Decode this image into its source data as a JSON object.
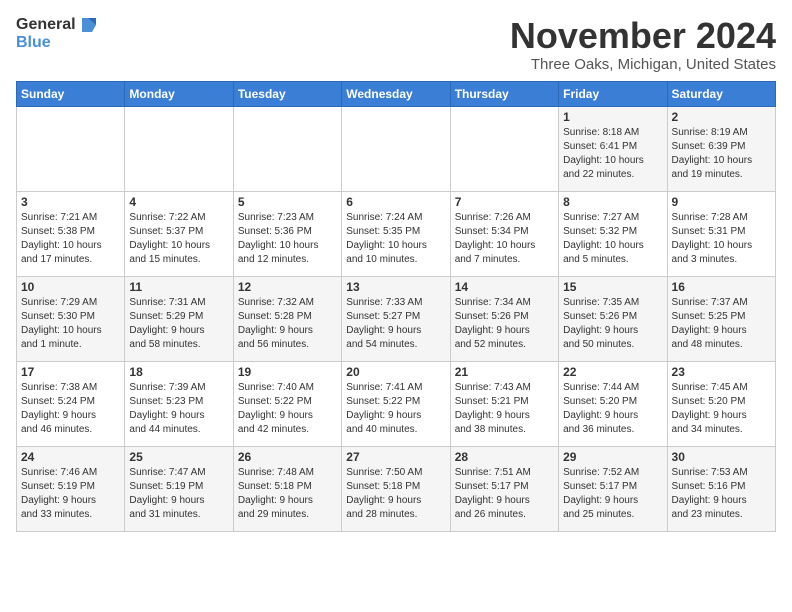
{
  "logo": {
    "line1": "General",
    "line2": "Blue"
  },
  "title": "November 2024",
  "location": "Three Oaks, Michigan, United States",
  "weekdays": [
    "Sunday",
    "Monday",
    "Tuesday",
    "Wednesday",
    "Thursday",
    "Friday",
    "Saturday"
  ],
  "weeks": [
    [
      {
        "day": "",
        "detail": ""
      },
      {
        "day": "",
        "detail": ""
      },
      {
        "day": "",
        "detail": ""
      },
      {
        "day": "",
        "detail": ""
      },
      {
        "day": "",
        "detail": ""
      },
      {
        "day": "1",
        "detail": "Sunrise: 8:18 AM\nSunset: 6:41 PM\nDaylight: 10 hours\nand 22 minutes."
      },
      {
        "day": "2",
        "detail": "Sunrise: 8:19 AM\nSunset: 6:39 PM\nDaylight: 10 hours\nand 19 minutes."
      }
    ],
    [
      {
        "day": "3",
        "detail": "Sunrise: 7:21 AM\nSunset: 5:38 PM\nDaylight: 10 hours\nand 17 minutes."
      },
      {
        "day": "4",
        "detail": "Sunrise: 7:22 AM\nSunset: 5:37 PM\nDaylight: 10 hours\nand 15 minutes."
      },
      {
        "day": "5",
        "detail": "Sunrise: 7:23 AM\nSunset: 5:36 PM\nDaylight: 10 hours\nand 12 minutes."
      },
      {
        "day": "6",
        "detail": "Sunrise: 7:24 AM\nSunset: 5:35 PM\nDaylight: 10 hours\nand 10 minutes."
      },
      {
        "day": "7",
        "detail": "Sunrise: 7:26 AM\nSunset: 5:34 PM\nDaylight: 10 hours\nand 7 minutes."
      },
      {
        "day": "8",
        "detail": "Sunrise: 7:27 AM\nSunset: 5:32 PM\nDaylight: 10 hours\nand 5 minutes."
      },
      {
        "day": "9",
        "detail": "Sunrise: 7:28 AM\nSunset: 5:31 PM\nDaylight: 10 hours\nand 3 minutes."
      }
    ],
    [
      {
        "day": "10",
        "detail": "Sunrise: 7:29 AM\nSunset: 5:30 PM\nDaylight: 10 hours\nand 1 minute."
      },
      {
        "day": "11",
        "detail": "Sunrise: 7:31 AM\nSunset: 5:29 PM\nDaylight: 9 hours\nand 58 minutes."
      },
      {
        "day": "12",
        "detail": "Sunrise: 7:32 AM\nSunset: 5:28 PM\nDaylight: 9 hours\nand 56 minutes."
      },
      {
        "day": "13",
        "detail": "Sunrise: 7:33 AM\nSunset: 5:27 PM\nDaylight: 9 hours\nand 54 minutes."
      },
      {
        "day": "14",
        "detail": "Sunrise: 7:34 AM\nSunset: 5:26 PM\nDaylight: 9 hours\nand 52 minutes."
      },
      {
        "day": "15",
        "detail": "Sunrise: 7:35 AM\nSunset: 5:26 PM\nDaylight: 9 hours\nand 50 minutes."
      },
      {
        "day": "16",
        "detail": "Sunrise: 7:37 AM\nSunset: 5:25 PM\nDaylight: 9 hours\nand 48 minutes."
      }
    ],
    [
      {
        "day": "17",
        "detail": "Sunrise: 7:38 AM\nSunset: 5:24 PM\nDaylight: 9 hours\nand 46 minutes."
      },
      {
        "day": "18",
        "detail": "Sunrise: 7:39 AM\nSunset: 5:23 PM\nDaylight: 9 hours\nand 44 minutes."
      },
      {
        "day": "19",
        "detail": "Sunrise: 7:40 AM\nSunset: 5:22 PM\nDaylight: 9 hours\nand 42 minutes."
      },
      {
        "day": "20",
        "detail": "Sunrise: 7:41 AM\nSunset: 5:22 PM\nDaylight: 9 hours\nand 40 minutes."
      },
      {
        "day": "21",
        "detail": "Sunrise: 7:43 AM\nSunset: 5:21 PM\nDaylight: 9 hours\nand 38 minutes."
      },
      {
        "day": "22",
        "detail": "Sunrise: 7:44 AM\nSunset: 5:20 PM\nDaylight: 9 hours\nand 36 minutes."
      },
      {
        "day": "23",
        "detail": "Sunrise: 7:45 AM\nSunset: 5:20 PM\nDaylight: 9 hours\nand 34 minutes."
      }
    ],
    [
      {
        "day": "24",
        "detail": "Sunrise: 7:46 AM\nSunset: 5:19 PM\nDaylight: 9 hours\nand 33 minutes."
      },
      {
        "day": "25",
        "detail": "Sunrise: 7:47 AM\nSunset: 5:19 PM\nDaylight: 9 hours\nand 31 minutes."
      },
      {
        "day": "26",
        "detail": "Sunrise: 7:48 AM\nSunset: 5:18 PM\nDaylight: 9 hours\nand 29 minutes."
      },
      {
        "day": "27",
        "detail": "Sunrise: 7:50 AM\nSunset: 5:18 PM\nDaylight: 9 hours\nand 28 minutes."
      },
      {
        "day": "28",
        "detail": "Sunrise: 7:51 AM\nSunset: 5:17 PM\nDaylight: 9 hours\nand 26 minutes."
      },
      {
        "day": "29",
        "detail": "Sunrise: 7:52 AM\nSunset: 5:17 PM\nDaylight: 9 hours\nand 25 minutes."
      },
      {
        "day": "30",
        "detail": "Sunrise: 7:53 AM\nSunset: 5:16 PM\nDaylight: 9 hours\nand 23 minutes."
      }
    ]
  ]
}
